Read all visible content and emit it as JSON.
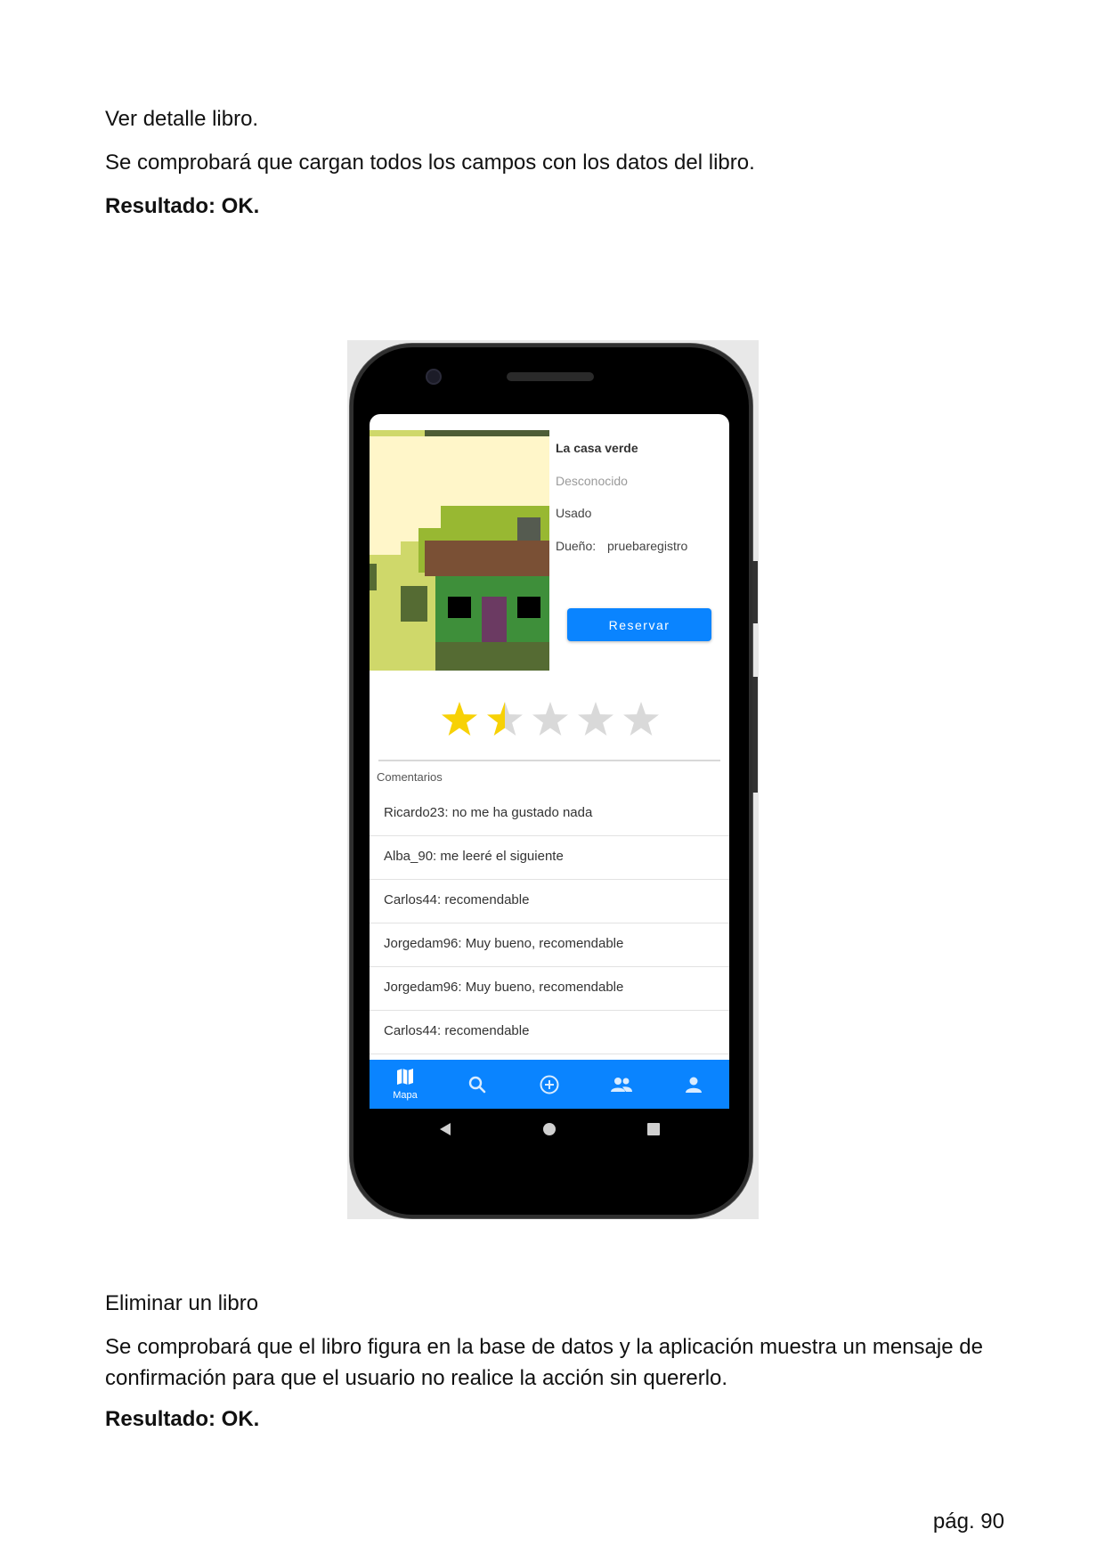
{
  "document": {
    "section1_title": "Ver detalle libro.",
    "section1_desc": "Se comprobará que cargan todos los campos con los datos del libro.",
    "section1_result": "Resultado: OK.",
    "section2_title": "Eliminar un libro",
    "section2_desc": "Se comprobará que el libro figura en la base de datos y la aplicación muestra un mensaje de confirmación para que el usuario no realice la acción sin quererlo.",
    "section2_result": "Resultado: OK.",
    "page_number": "pág. 90"
  },
  "app": {
    "book": {
      "title": "La casa verde",
      "author": "Desconocido",
      "condition": "Usado",
      "owner_label": "Dueño:",
      "owner_value": "pruebaregistro"
    },
    "reserve_button": "Reservar",
    "rating": {
      "value": 1.5,
      "max": 5,
      "filled_color": "#f7d106",
      "empty_color": "#d9d9d9"
    },
    "comments_heading": "Comentarios",
    "comments": [
      "Ricardo23: no me ha gustado nada",
      "Alba_90: me leeré el siguiente",
      "Carlos44: recomendable",
      "Jorgedam96: Muy bueno, recomendable",
      "Jorgedam96: Muy bueno, recomendable",
      "Carlos44: recomendable"
    ],
    "nav": {
      "active_label": "Mapa",
      "items": [
        "map-icon",
        "search-icon",
        "add-circle-icon",
        "people-icon",
        "person-icon"
      ]
    },
    "colors": {
      "primary": "#0a84ff"
    }
  }
}
